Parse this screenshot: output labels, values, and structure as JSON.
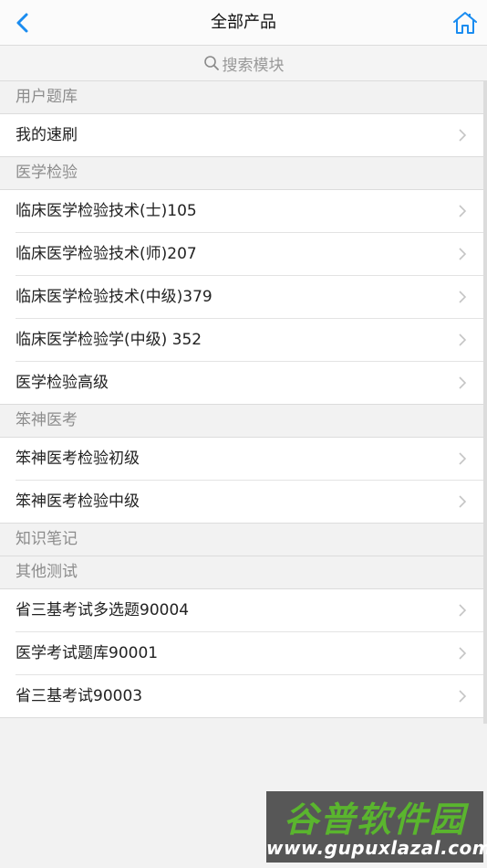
{
  "header": {
    "title": "全部产品",
    "back_icon": "chevron-left-icon",
    "home_icon": "home-icon",
    "accent_color": "#1a8cf0"
  },
  "search": {
    "placeholder": "搜索模块",
    "icon": "search-icon"
  },
  "sections": [
    {
      "title": "用户题库",
      "items": [
        "我的速刷"
      ]
    },
    {
      "title": "医学检验",
      "items": [
        "临床医学检验技术(士)105",
        "临床医学检验技术(师)207",
        "临床医学检验技术(中级)379",
        "临床医学检验学(中级) 352",
        "医学检验高级"
      ]
    },
    {
      "title": "笨神医考",
      "items": [
        "笨神医考检验初级",
        "笨神医考检验中级"
      ]
    },
    {
      "title": "知识笔记",
      "items": []
    },
    {
      "title": "其他测试",
      "items": [
        "省三基考试多选题90004",
        "医学考试题库90001",
        "省三基考试90003"
      ]
    }
  ],
  "watermark": {
    "brand": "谷普软件园",
    "url": "www.gupuxlazal.com"
  }
}
